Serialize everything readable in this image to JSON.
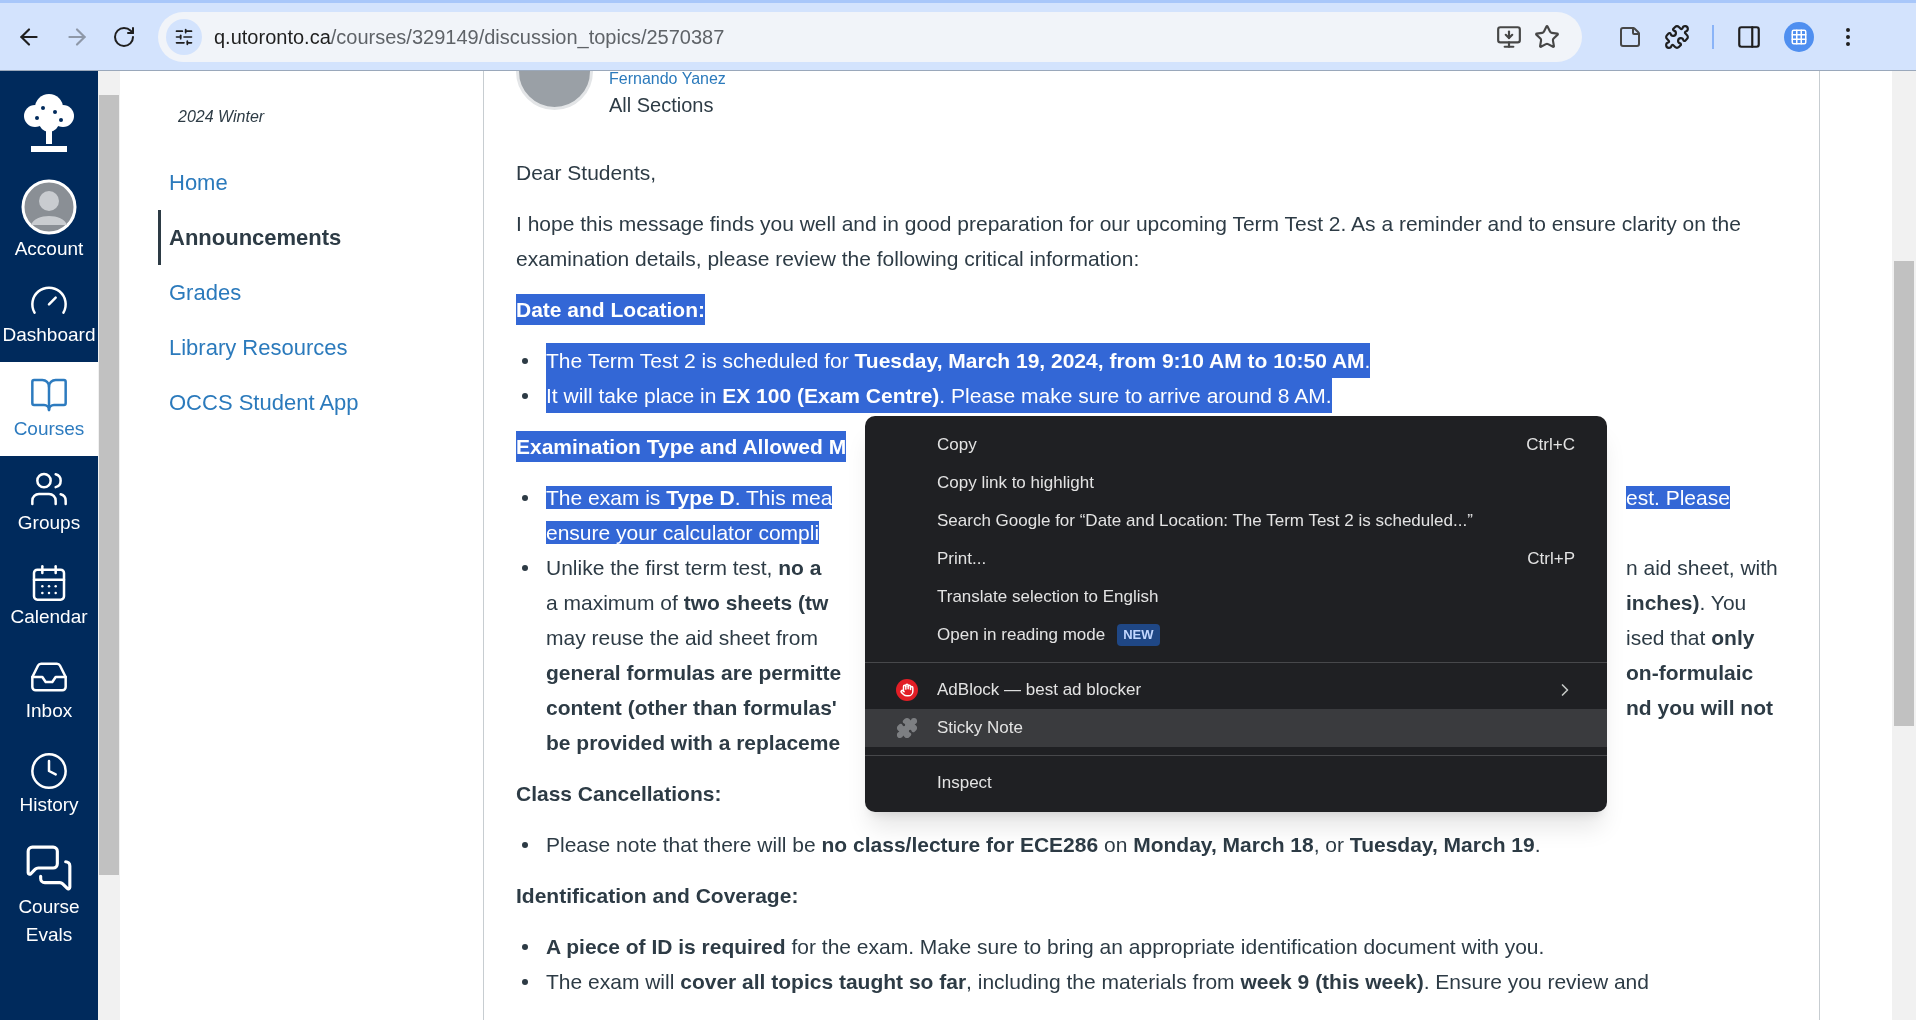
{
  "browser": {
    "url_host": "q.utoronto.ca",
    "url_path": "/courses/329149/discussion_topics/2570387",
    "forward_enabled": false
  },
  "global_nav": [
    {
      "kind": "account",
      "label": "Account",
      "selected": false
    },
    {
      "kind": "dashboard",
      "label": "Dashboard",
      "selected": false
    },
    {
      "kind": "courses",
      "label": "Courses",
      "selected": true
    },
    {
      "kind": "groups",
      "label": "Groups",
      "selected": false
    },
    {
      "kind": "calendar",
      "label": "Calendar",
      "selected": false
    },
    {
      "kind": "inbox",
      "label": "Inbox",
      "selected": false
    },
    {
      "kind": "history",
      "label": "History",
      "selected": false
    },
    {
      "kind": "evals",
      "label": "Course Evals",
      "selected": false
    }
  ],
  "course_nav": {
    "term": "2024 Winter",
    "items": [
      {
        "label": "Home",
        "selected": false
      },
      {
        "label": "Announcements",
        "selected": true
      },
      {
        "label": "Grades",
        "selected": false
      },
      {
        "label": "Library Resources",
        "selected": false
      },
      {
        "label": "OCCS Student App",
        "selected": false
      }
    ]
  },
  "post": {
    "author": "Fernando Yanez",
    "audience": "All Sections",
    "blocks": [
      {
        "kind": "paragraph",
        "text": "Dear Students,",
        "selected": false
      },
      {
        "kind": "paragraph",
        "text": "I hope this message finds you well and in good preparation for our upcoming Term Test 2. As a reminder and to ensure clarity on the examination details, please review the following critical information:",
        "selected": false
      },
      {
        "kind": "heading",
        "text": "Date and Location:",
        "selected": true
      },
      {
        "kind": "list",
        "items": [
          {
            "text": "The Term Test 2 is scheduled for **Tuesday, March 19, 2024, from 9:10 AM to 10:50 AM**.",
            "selected": true
          },
          {
            "text": "It will take place in **EX 100 (Exam Centre)**. Please make sure to arrive around 8 AM.",
            "selected": true
          }
        ]
      },
      {
        "kind": "heading",
        "text": "Examination Type and Allowed M",
        "selected": true
      },
      {
        "kind": "list",
        "items": [
          {
            "selected": true,
            "lines": [
              {
                "left": "The exam is **Type D**. This mea",
                "right": "est. Please"
              },
              {
                "left": "ensure your calculator compli"
              }
            ]
          },
          {
            "selected": false,
            "lines": [
              {
                "left": "Unlike the first term test, **no a**",
                "right": "n aid sheet, with"
              },
              {
                "left": "a maximum of **two sheets (tw**",
                "right": "**inches)**. You"
              },
              {
                "left": "may reuse the aid sheet from",
                "right": "ised that **only**"
              },
              {
                "left": "**general formulas are permitte**",
                "right": "**on-formulaic**"
              },
              {
                "left": "**content (other than formulas'**",
                "right": "**nd you will not**"
              },
              {
                "left": "**be provided with a replaceme**"
              }
            ]
          }
        ]
      },
      {
        "kind": "heading",
        "text": "Class Cancellations:",
        "selected": false
      },
      {
        "kind": "list",
        "items": [
          {
            "text": "Please note that there will be **no class/lecture for ECE286** on **Monday, March 18**, or **Tuesday, March 19**.",
            "selected": false
          }
        ]
      },
      {
        "kind": "heading",
        "text": "Identification and Coverage:",
        "selected": false
      },
      {
        "kind": "list",
        "items": [
          {
            "text": "**A piece of ID is required** for the exam. Make sure to bring an appropriate identification document with you.",
            "selected": false
          },
          {
            "text": "The exam will **cover all topics taught so far**, including the materials from **week 9 (this week)**. Ensure you review and",
            "selected": false
          }
        ]
      }
    ]
  },
  "context_menu": {
    "groups": [
      [
        {
          "kind": "command",
          "label": "Copy",
          "shortcut": "Ctrl+C",
          "highlighted": false,
          "submenu": false
        },
        {
          "kind": "command",
          "label": "Copy link to highlight",
          "highlighted": false,
          "submenu": false
        },
        {
          "kind": "command",
          "label": "Search Google for “Date and Location:  The Term Test 2 is scheduled...”",
          "highlighted": false,
          "submenu": false
        },
        {
          "kind": "command",
          "label": "Print...",
          "shortcut": "Ctrl+P",
          "highlighted": false,
          "submenu": false
        },
        {
          "kind": "command",
          "label": "Translate selection to English",
          "highlighted": false,
          "submenu": false
        },
        {
          "kind": "command",
          "label": "Open in reading mode",
          "badge": "NEW",
          "highlighted": false,
          "submenu": false
        }
      ],
      [
        {
          "kind": "blocker",
          "label": "AdBlock — best ad blocker",
          "highlighted": false,
          "submenu": true
        },
        {
          "kind": "plugin",
          "label": "Sticky Note",
          "highlighted": true,
          "submenu": false
        }
      ],
      [
        {
          "kind": "command",
          "label": "Inspect",
          "highlighted": false,
          "submenu": false
        }
      ]
    ]
  }
}
